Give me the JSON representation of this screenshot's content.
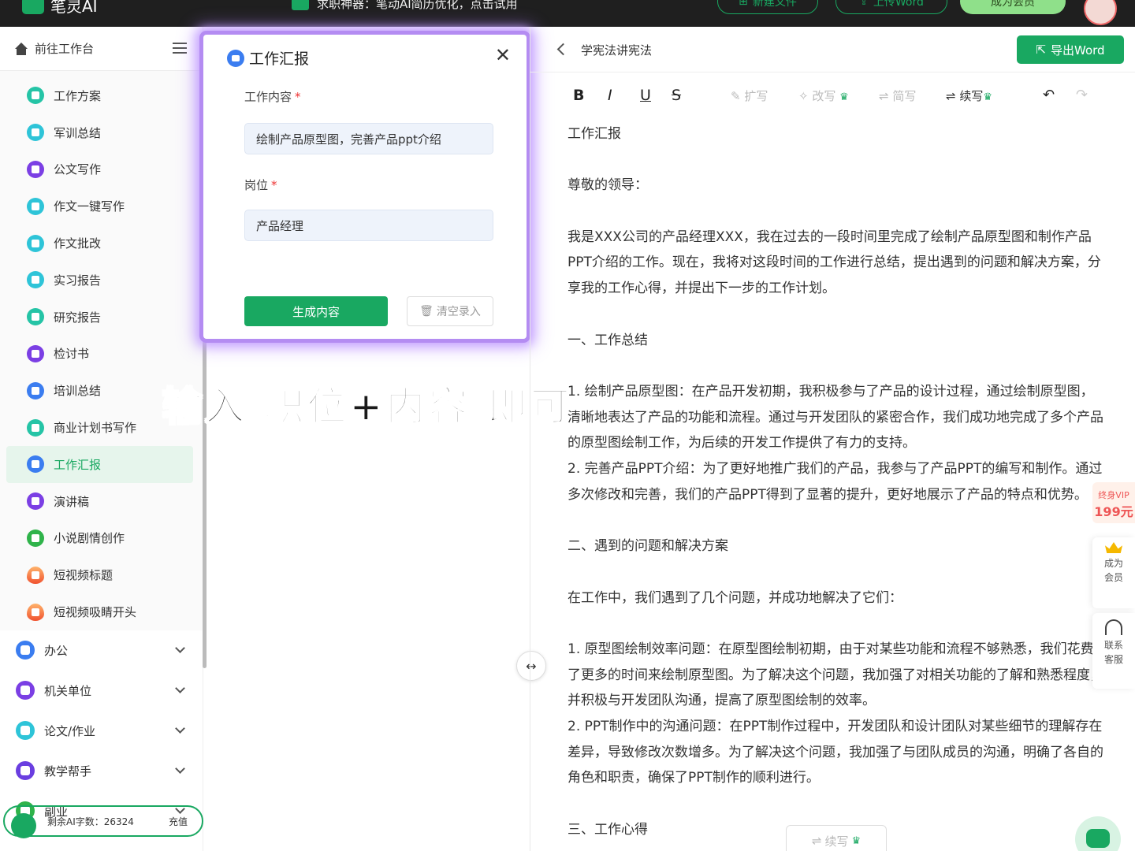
{
  "topbar": {
    "brand": "笔灵AI",
    "announcement": "求职神器：笔动AI简历优化，点击试用",
    "new_file": "新建文件",
    "upload_word": "上传Word",
    "become_member": "成为会员"
  },
  "sidebar": {
    "home": "前往工作台",
    "tools": [
      {
        "label": "工作方案",
        "color": "teal"
      },
      {
        "label": "军训总结",
        "color": "cyan"
      },
      {
        "label": "公文写作",
        "color": "purple"
      },
      {
        "label": "作文一键写作",
        "color": "cyan"
      },
      {
        "label": "作文批改",
        "color": "cyan"
      },
      {
        "label": "实习报告",
        "color": "cyan"
      },
      {
        "label": "研究报告",
        "color": "teal"
      },
      {
        "label": "检讨书",
        "color": "purple"
      },
      {
        "label": "培训总结",
        "color": "blue"
      },
      {
        "label": "商业计划书写作",
        "color": "teal"
      },
      {
        "label": "工作汇报",
        "color": "blue",
        "active": true
      },
      {
        "label": "演讲稿",
        "color": "purple"
      },
      {
        "label": "小说剧情创作",
        "color": "green"
      },
      {
        "label": "短视频标题",
        "color": "fire"
      },
      {
        "label": "短视频吸睛开头",
        "color": "fire"
      }
    ],
    "categories": [
      {
        "label": "办公",
        "color": "#3b7df0"
      },
      {
        "label": "机关单位",
        "color": "#7b3fe4"
      },
      {
        "label": "论文/作业",
        "color": "#2ec4d8"
      },
      {
        "label": "教学帮手",
        "color": "#6a3ee0"
      },
      {
        "label": "副业",
        "color": "#2fb34a"
      }
    ],
    "bottom": {
      "left": "剩余AI字数：26324",
      "right": "充值"
    }
  },
  "form": {
    "title": "工作汇报",
    "content_label": "工作内容",
    "content_value": "绘制产品原型图，完善产品ppt介绍",
    "position_label": "岗位",
    "position_value": "产品经理",
    "required_mark": "*",
    "generate": "生成内容",
    "clear": "清空录入"
  },
  "overlay": "输入 职位+内容 即可",
  "editor": {
    "doc_title": "学宪法讲宪法",
    "export": "导出Word",
    "toolbar": {
      "bold": "B",
      "italic": "I",
      "underline": "U",
      "strike": "S",
      "expand": "扩写",
      "rewrite": "改写",
      "simplify": "简写",
      "continue": "续写"
    },
    "paragraphs": [
      "工作汇报",
      "",
      "尊敬的领导：",
      "",
      "我是XXX公司的产品经理XXX，我在过去的一段时间里完成了绘制产品原型图和制作产品PPT介绍的工作。现在，我将对这段时间的工作进行总结，提出遇到的问题和解决方案，分享我的工作心得，并提出下一步的工作计划。",
      "",
      "一、工作总结",
      "",
      "1. 绘制产品原型图：在产品开发初期，我积极参与了产品的设计过程，通过绘制原型图，清晰地表达了产品的功能和流程。通过与开发团队的紧密合作，我们成功地完成了多个产品的原型图绘制工作，为后续的开发工作提供了有力的支持。",
      "2. 完善产品PPT介绍：为了更好地推广我们的产品，我参与了产品PPT的编写和制作。通过多次修改和完善，我们的产品PPT得到了显著的提升，更好地展示了产品的特点和优势。",
      "",
      "二、遇到的问题和解决方案",
      "",
      "在工作中，我们遇到了几个问题，并成功地解决了它们：",
      "",
      "1. 原型图绘制效率问题：在原型图绘制初期，由于对某些功能和流程不够熟悉，我们花费了更多的时间来绘制原型图。为了解决这个问题，我加强了对相关功能的了解和熟悉程度，并积极与开发团队沟通，提高了原型图绘制的效率。",
      "2. PPT制作中的沟通问题：在PPT制作过程中，开发团队和设计团队对某些细节的理解存在差异，导致修改次数增多。为了解决这个问题，我加强了与团队成员的沟通，明确了各自的角色和职责，确保了PPT制作的顺利进行。",
      "",
      "三、工作心得"
    ],
    "floating_continue": "续写"
  },
  "right_float": {
    "vip_line1": "终身VIP",
    "vip_price": "199元",
    "member": "成为会员",
    "service": "联系客服"
  },
  "colors": {
    "brand_green": "#19a861",
    "highlight_purple": "#b48cf2"
  }
}
